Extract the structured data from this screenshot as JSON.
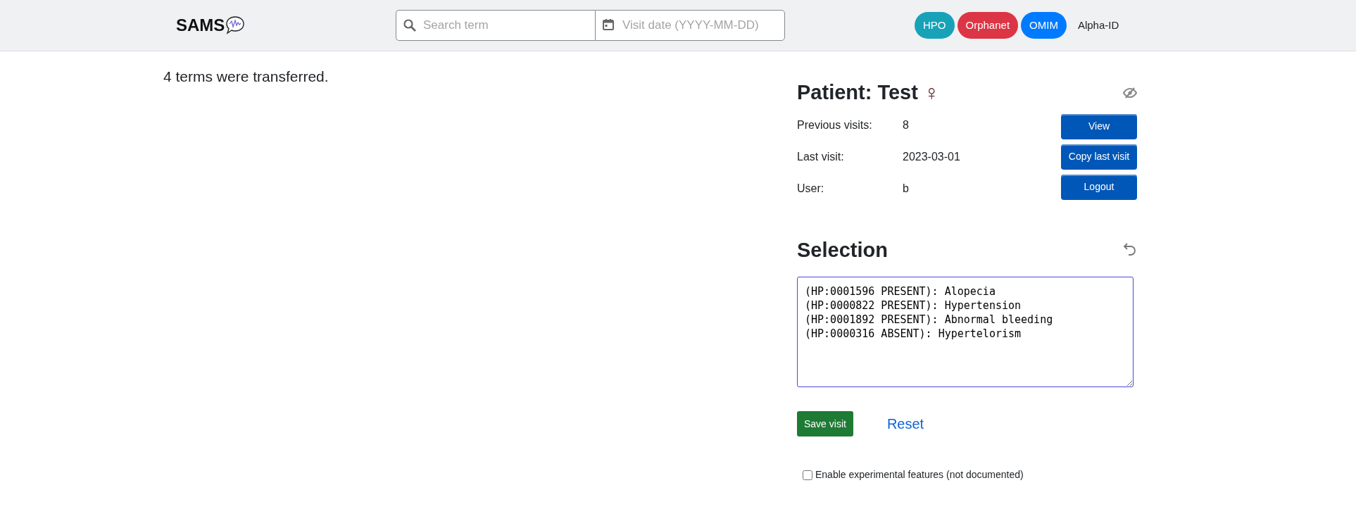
{
  "header": {
    "logo": "SAMS",
    "search": {
      "placeholder": "Search term"
    },
    "date": {
      "placeholder": "Visit date (YYYY-MM-DD)"
    },
    "sources": [
      {
        "label": "HPO",
        "selected": true,
        "color": "#17a2b8"
      },
      {
        "label": "Orphanet",
        "selected": true,
        "color": "#dc3545"
      },
      {
        "label": "OMIM",
        "selected": true,
        "color": "#007bff"
      },
      {
        "label": "Alpha-ID",
        "selected": false,
        "color": "#222222"
      }
    ]
  },
  "message": "4 terms were transferred.",
  "patient": {
    "title": "Patient: Test",
    "sex_symbol": "♀",
    "fields": [
      {
        "label": "Previous visits:",
        "value": "8"
      },
      {
        "label": "Last visit:",
        "value": "2023-03-01"
      },
      {
        "label": "User:",
        "value": "b"
      }
    ],
    "buttons": [
      "View",
      "Copy last visit",
      "Logout"
    ]
  },
  "selection": {
    "title": "Selection",
    "lines": [
      "(HP:0001596 PRESENT): Alopecia",
      "(HP:0000822 PRESENT): Hypertension",
      "(HP:0001892 PRESENT): Abnormal bleeding",
      "(HP:0000316 ABSENT): Hypertelorism"
    ],
    "save": "Save visit",
    "reset": "Reset"
  },
  "experimental": {
    "label": "Enable experimental features (not documented)",
    "checked": false
  }
}
